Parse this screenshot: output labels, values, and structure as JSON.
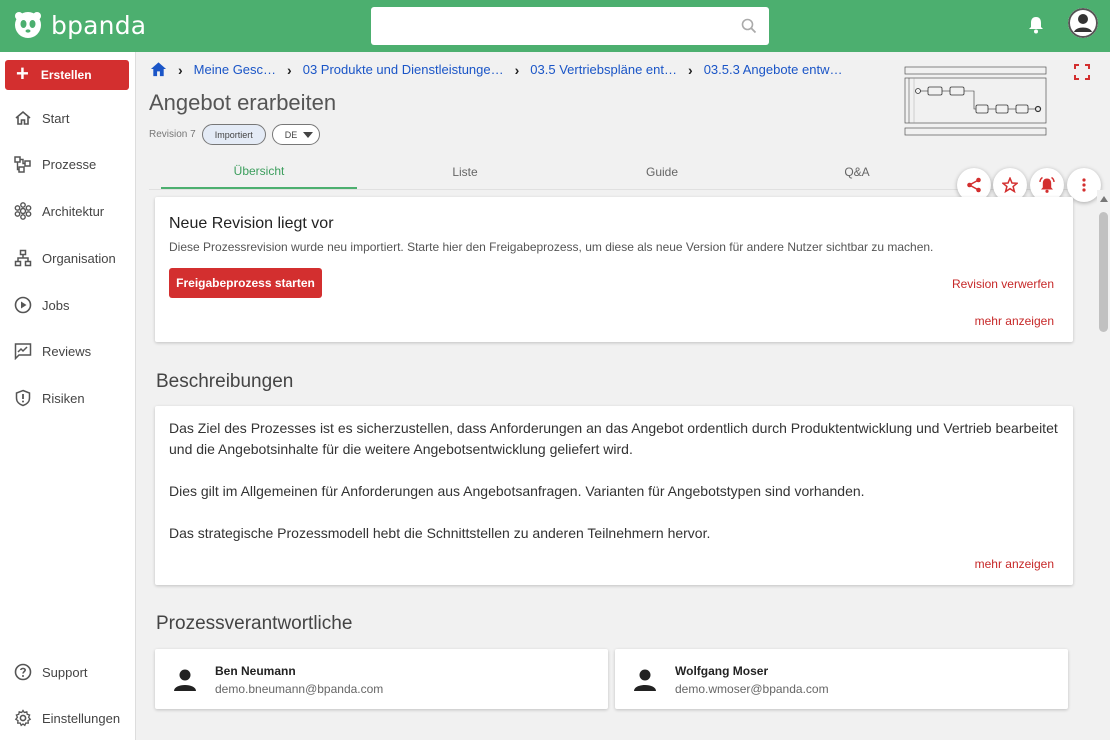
{
  "app": {
    "name": "bpanda"
  },
  "search": {
    "placeholder": ""
  },
  "sidebar": {
    "create_label": "Erstellen",
    "items": [
      {
        "label": "Start",
        "icon": "home-icon"
      },
      {
        "label": "Prozesse",
        "icon": "process-icon"
      },
      {
        "label": "Architektur",
        "icon": "architecture-icon"
      },
      {
        "label": "Organisation",
        "icon": "org-chart-icon"
      },
      {
        "label": "Jobs",
        "icon": "play-circle-icon"
      },
      {
        "label": "Reviews",
        "icon": "review-icon"
      },
      {
        "label": "Risiken",
        "icon": "shield-alert-icon"
      }
    ],
    "bottom_items": [
      {
        "label": "Support",
        "icon": "help-icon"
      },
      {
        "label": "Einstellungen",
        "icon": "gear-icon"
      }
    ]
  },
  "breadcrumb": {
    "items": [
      "Meine Gesc…",
      "03 Produkte und Dienstleistunge…",
      "03.5 Vertriebspläne ent…",
      "03.5.3 Angebote entw…"
    ]
  },
  "page": {
    "title": "Angebot erarbeiten",
    "revision": "Revision 7",
    "status_chip": "Importiert",
    "language": "DE"
  },
  "tabs": [
    "Übersicht",
    "Liste",
    "Guide",
    "Q&A"
  ],
  "revision_card": {
    "title": "Neue Revision liegt vor",
    "text": "Diese Prozessrevision wurde neu importiert. Starte hier den Freigabeprozess, um diese als neue Version für andere Nutzer sichtbar zu machen.",
    "start_button": "Freigabeprozess starten",
    "discard_link": "Revision verwerfen",
    "more_link": "mehr anzeigen"
  },
  "descriptions": {
    "title": "Beschreibungen",
    "paragraphs": [
      "Das Ziel des Prozesses ist es sicherzustellen, dass Anforderungen an das Angebot ordentlich durch Produktentwicklung und Vertrieb bearbeitet und die Angebotsinhalte für die weitere Angebotsentwicklung geliefert wird.",
      "Dies gilt im Allgemeinen für Anforderungen aus Angebotsanfragen. Varianten für Angebotstypen sind vorhanden.",
      "Das strategische Prozessmodell hebt die Schnittstellen zu anderen Teilnehmern hervor."
    ],
    "more_link": "mehr anzeigen"
  },
  "owners": {
    "title": "Prozessverantwortliche",
    "people": [
      {
        "name": "Ben Neumann",
        "email": "demo.bneumann@bpanda.com"
      },
      {
        "name": "Wolfgang Moser",
        "email": "demo.wmoser@bpanda.com"
      }
    ]
  },
  "colors": {
    "brand": "#4caf6f",
    "accent": "#d32f2f",
    "link": "#1a55c7"
  }
}
